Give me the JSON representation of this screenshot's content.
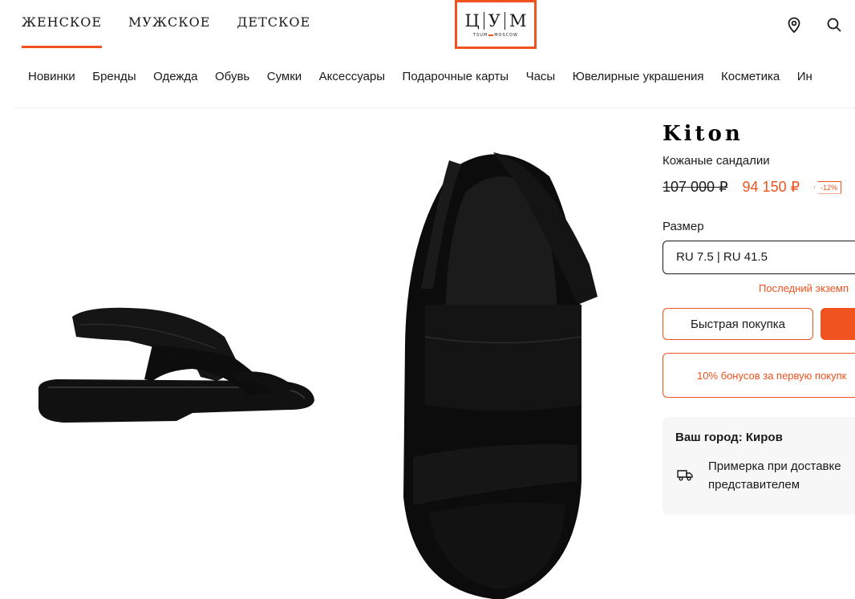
{
  "header": {
    "gender_tabs": [
      "ЖЕНСКОЕ",
      "МУЖСКОЕ",
      "ДЕТСКОЕ"
    ],
    "active_tab": "ЖЕНСКОЕ",
    "logo": {
      "letters": [
        "Ц",
        "У",
        "М"
      ],
      "subtitle_left": "TSUM",
      "subtitle_right": "MOSCOW"
    },
    "icons": [
      "location-pin-icon",
      "search-icon"
    ],
    "accent_color": "#f0531f"
  },
  "category_nav": [
    "Новинки",
    "Бренды",
    "Одежда",
    "Обувь",
    "Сумки",
    "Аксессуары",
    "Подарочные карты",
    "Часы",
    "Ювелирные украшения",
    "Косметика",
    "Ин"
  ],
  "product": {
    "brand": "Kiton",
    "name": "Кожаные сандалии",
    "old_price": "107 000 ₽",
    "new_price": "94 150 ₽",
    "discount": "-12%",
    "size_label": "Размер",
    "size_value": "RU 7.5 | RU 41.5",
    "stock_note": "Последний экземп",
    "quick_buy_label": "Быстрая покупка",
    "bonus_text": "10% бонусов за первую покупк"
  },
  "delivery": {
    "city_title": "Ваш город: Киров",
    "line1": "Примерка при доставке",
    "line2": "представителем",
    "icon": "truck-icon"
  }
}
